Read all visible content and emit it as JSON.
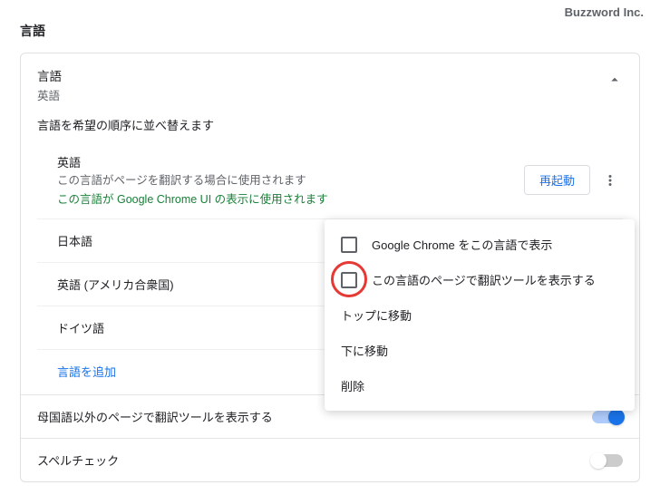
{
  "watermark": "Buzzword Inc.",
  "pageTitle": "言語",
  "section": {
    "title": "言語",
    "sub": "英語",
    "sortHint": "言語を希望の順序に並べ替えます",
    "languages": [
      {
        "name": "英語",
        "note": "この言語がページを翻訳する場合に使用されます",
        "ui": "この言語が Google Chrome UI の表示に使用されます"
      },
      {
        "name": "日本語"
      },
      {
        "name": "英語 (アメリカ合衆国)"
      },
      {
        "name": "ドイツ語"
      }
    ],
    "restartLabel": "再起動",
    "addLabel": "言語を追加"
  },
  "toggles": {
    "translate": "母国語以外のページで翻訳ツールを表示する",
    "spell": "スペルチェック"
  },
  "menu": {
    "showUI": "Google Chrome をこの言語で表示",
    "showTool": "この言語のページで翻訳ツールを表示する",
    "moveTop": "トップに移動",
    "moveDown": "下に移動",
    "remove": "削除"
  }
}
